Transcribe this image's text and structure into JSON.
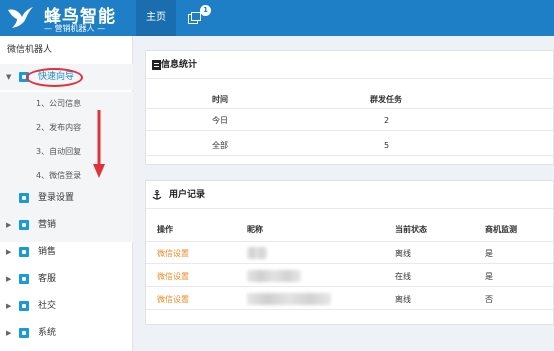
{
  "brand": {
    "title": "蜂鸟智能",
    "subtitle": "— 营销机器人 —"
  },
  "topnav": {
    "home_label": "主页",
    "message_badge": "1"
  },
  "sidebar": {
    "header": "微信机器人",
    "quick_guide": {
      "label": "快速向导",
      "steps": [
        "1、公司信息",
        "2、发布内容",
        "3、自动回复",
        "4、微信登录"
      ]
    },
    "items": [
      {
        "label": "登录设置"
      },
      {
        "label": "营销"
      },
      {
        "label": "销售"
      },
      {
        "label": "客服"
      },
      {
        "label": "社交"
      },
      {
        "label": "系统"
      }
    ]
  },
  "stats": {
    "title": "信息统计",
    "columns": [
      "时间",
      "群发任务"
    ],
    "rows": [
      {
        "time": "今日",
        "tasks": "2"
      },
      {
        "time": "全部",
        "tasks": "5"
      }
    ]
  },
  "users": {
    "title": "用户记录",
    "columns": [
      "操作",
      "昵称",
      "当前状态",
      "商机监测"
    ],
    "rows": [
      {
        "action": "微信设置",
        "status": "离线",
        "monitor": "是"
      },
      {
        "action": "微信设置",
        "status": "在线",
        "monitor": "是"
      },
      {
        "action": "微信设置",
        "status": "离线",
        "monitor": "否"
      }
    ]
  },
  "colors": {
    "topbar": "#1e7fc6",
    "accent": "#1a9ad6",
    "link": "#f08a24",
    "annotation": "#e0323a"
  }
}
